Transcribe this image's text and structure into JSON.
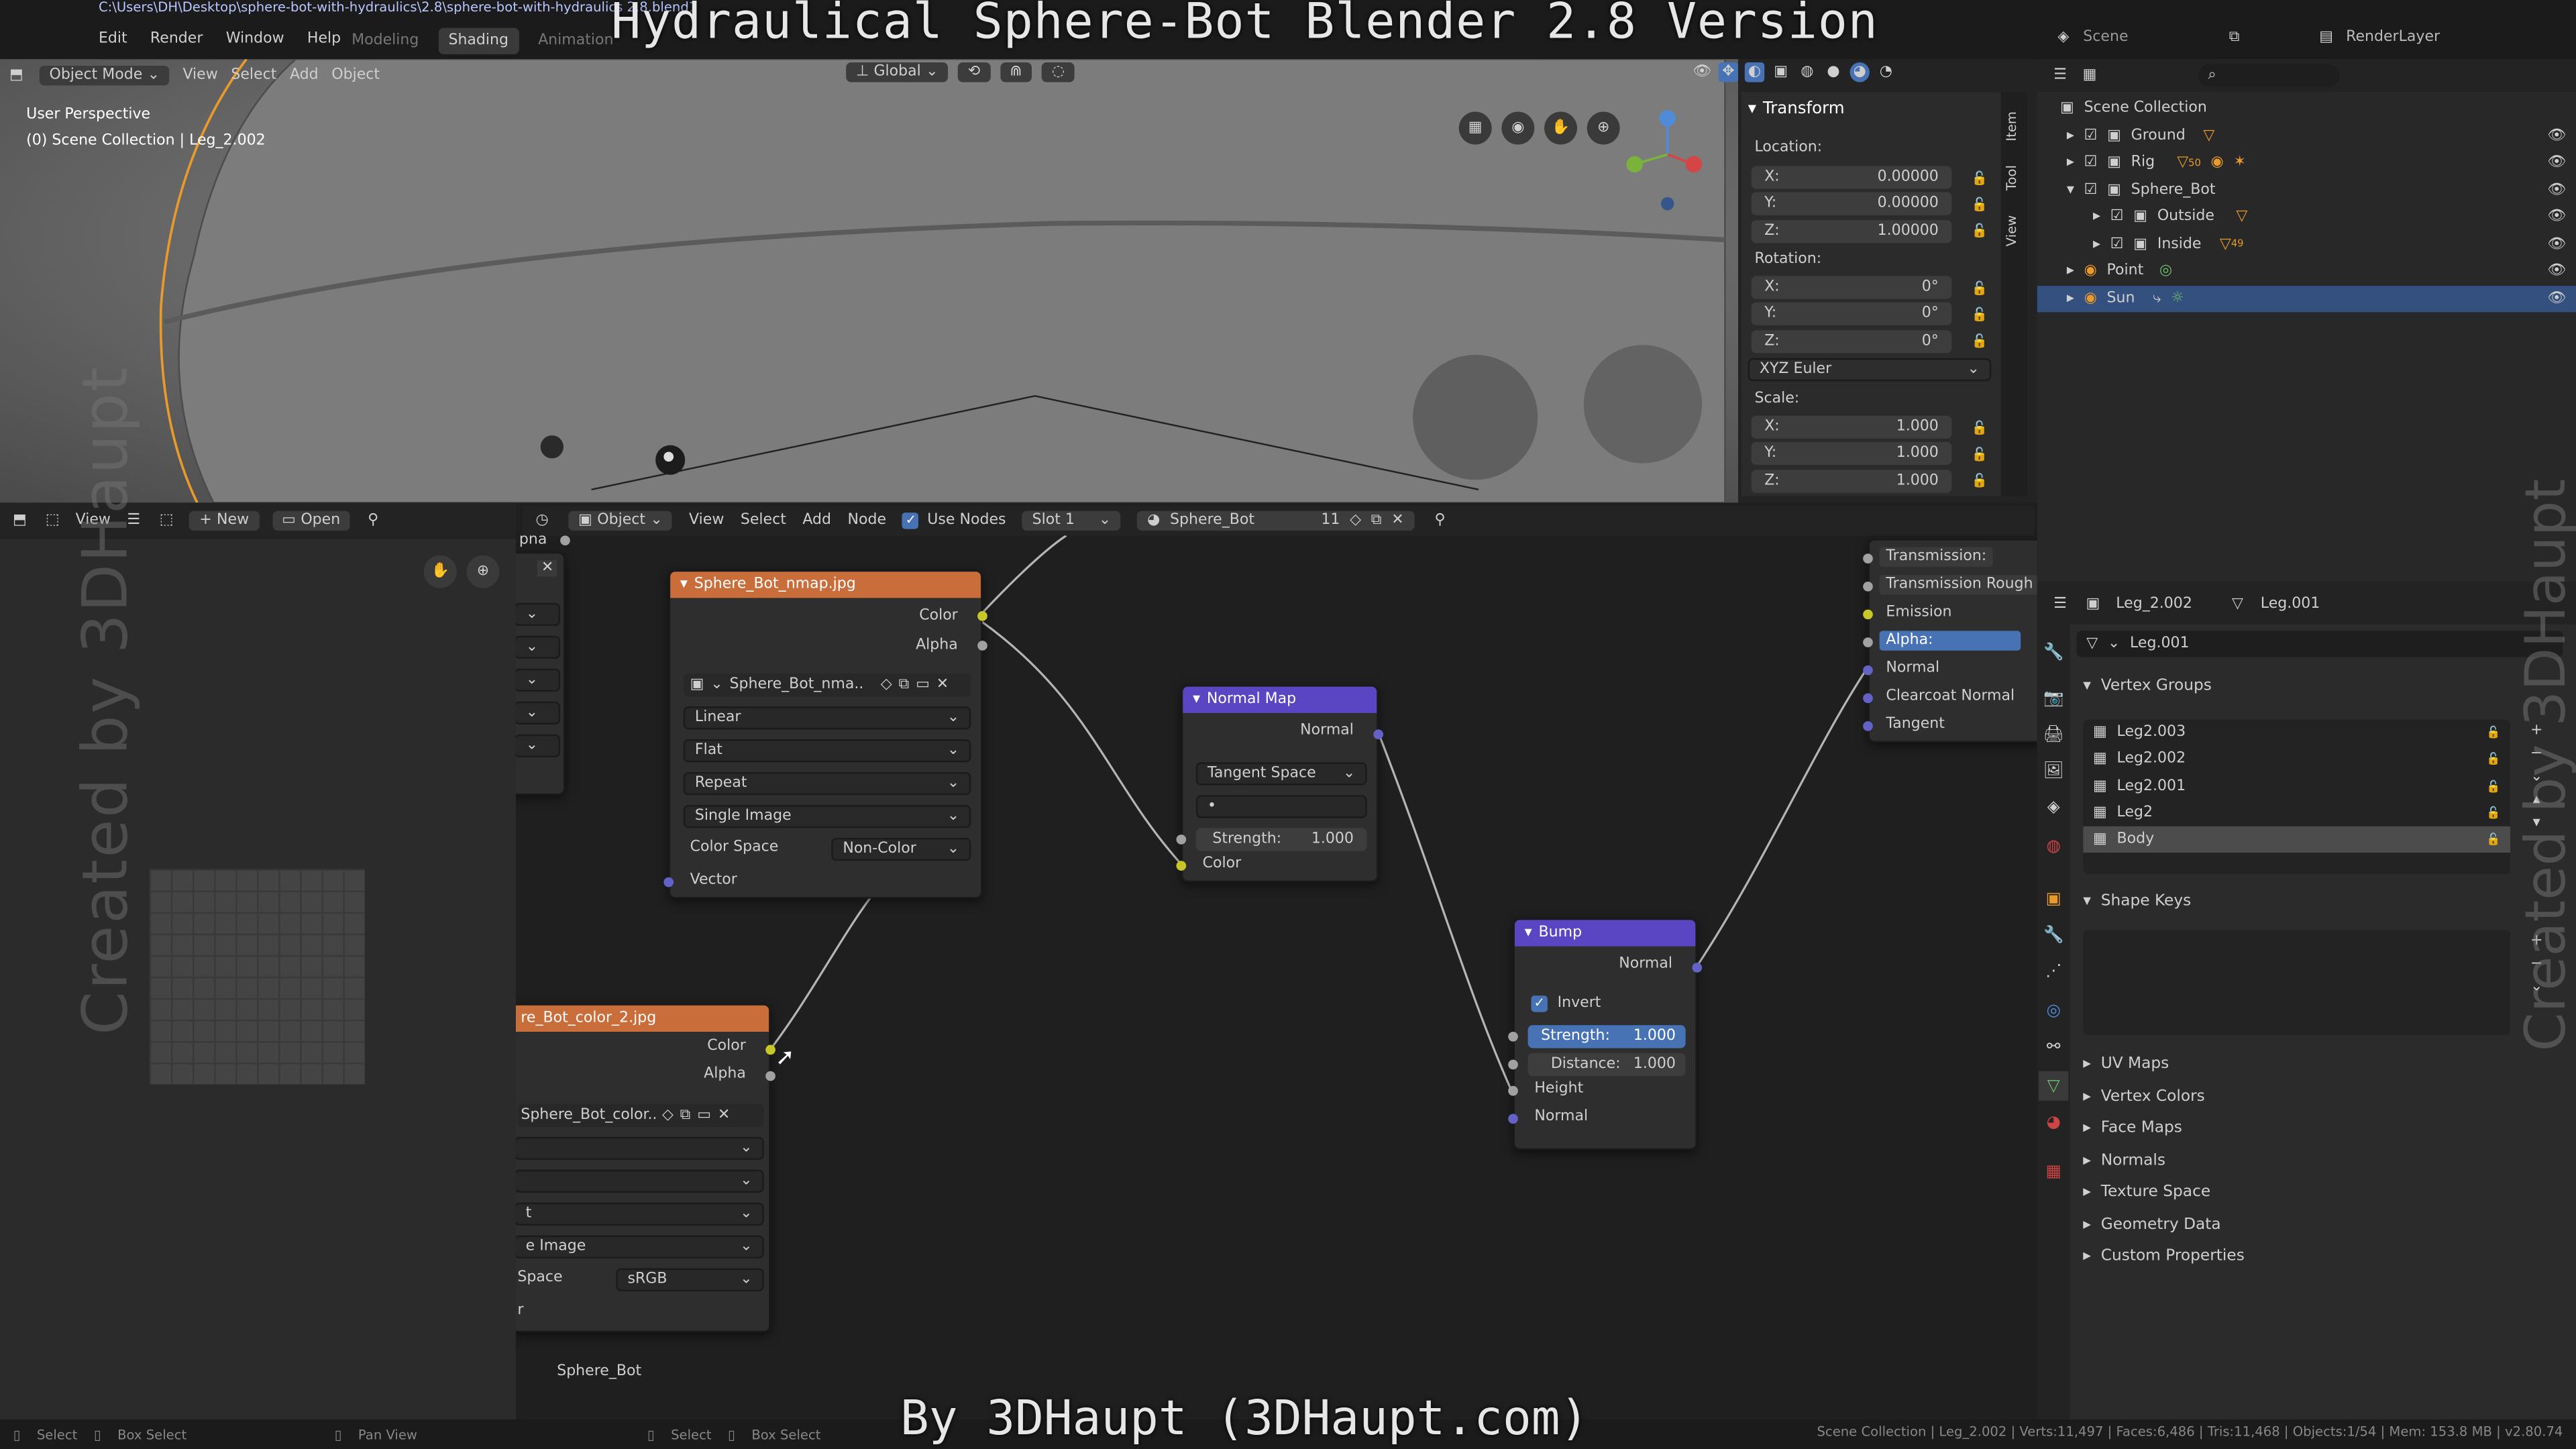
{
  "overlay": {
    "title": "Hydraulical Sphere-Bot Blender 2.8 Version",
    "credit": "By 3DHaupt (3DHaupt.com)",
    "watermark": "Created by 3DHaupt"
  },
  "titlebar": {
    "path": "C:\\Users\\DH\\Desktop\\sphere-bot-with-hydraulics\\2.8\\sphere-bot-with-hydraulics 2.8.blend1"
  },
  "topbar": {
    "menus": [
      "Edit",
      "Render",
      "Window",
      "Help"
    ],
    "workspaces": [
      "Modeling",
      "Shading",
      "Animation"
    ],
    "scene": "Scene",
    "render_layer": "RenderLayer"
  },
  "viewport": {
    "mode": "Object Mode",
    "menus": [
      "View",
      "Select",
      "Add",
      "Object"
    ],
    "transform_orientation": "Global",
    "perspective_label": "User Perspective",
    "collection_label": "(0) Scene Collection | Leg_2.002",
    "side_tabs": [
      "Item",
      "Tool",
      "View"
    ]
  },
  "transform": {
    "title": "Transform",
    "location_label": "Location:",
    "location": [
      {
        "axis": "X:",
        "value": "0.00000"
      },
      {
        "axis": "Y:",
        "value": "0.00000"
      },
      {
        "axis": "Z:",
        "value": "1.00000"
      }
    ],
    "rotation_label": "Rotation:",
    "rotation": [
      {
        "axis": "X:",
        "value": "0°"
      },
      {
        "axis": "Y:",
        "value": "0°"
      },
      {
        "axis": "Z:",
        "value": "0°"
      }
    ],
    "rotation_mode": "XYZ Euler",
    "scale_label": "Scale:",
    "scale": [
      {
        "axis": "X:",
        "value": "1.000"
      },
      {
        "axis": "Y:",
        "value": "1.000"
      },
      {
        "axis": "Z:",
        "value": "1.000"
      }
    ]
  },
  "outliner": {
    "root": "Scene Collection",
    "items": [
      "Ground",
      "Rig",
      "Sphere_Bot",
      "Outside",
      "Inside",
      "Point",
      "Sun"
    ],
    "count_a": "50",
    "count_b": "49"
  },
  "image_editor": {
    "view": "View",
    "new": "New",
    "open": "Open"
  },
  "node_editor": {
    "object": "Object",
    "menus": [
      "View",
      "Select",
      "Add",
      "Node"
    ],
    "use_nodes": "Use Nodes",
    "slot": "Slot 1",
    "material": "Sphere_Bot",
    "users": "11",
    "footer_material": "Sphere_Bot",
    "partial_label": "pha"
  },
  "node_nmap": {
    "title": "Sphere_Bot_nmap.jpg",
    "outputs": [
      "Color",
      "Alpha"
    ],
    "image": "Sphere_Bot_nma..",
    "interpolation": "Linear",
    "projection": "Flat",
    "extension": "Repeat",
    "source": "Single Image",
    "color_space_label": "Color Space",
    "color_space": "Non-Color",
    "input": "Vector"
  },
  "node_color": {
    "title": "re_Bot_color_2.jpg",
    "outputs": [
      "Color",
      "Alpha"
    ],
    "image": "Sphere_Bot_color..",
    "row_t": "t",
    "source": "e Image",
    "color_space_label": "Space",
    "color_space": "sRGB",
    "row_r": "r"
  },
  "node_normal": {
    "title": "Normal Map",
    "output": "Normal",
    "space": "Tangent Space",
    "uv": "•",
    "strength_label": "Strength:",
    "strength": "1.000",
    "input": "Color"
  },
  "node_bump": {
    "title": "Bump",
    "output": "Normal",
    "invert": "Invert",
    "strength_label": "Strength:",
    "strength": "1.000",
    "distance_label": "Distance:",
    "distance": "1.000",
    "inputs": [
      "Height",
      "Normal"
    ]
  },
  "node_bsdf": {
    "inputs": [
      "Transmission:",
      "Transmission Rough",
      "Emission",
      "Alpha:",
      "Normal",
      "Clearcoat Normal",
      "Tangent"
    ]
  },
  "properties": {
    "object": "Leg_2.002",
    "mesh": "Leg.001",
    "mesh_field": "Leg.001",
    "vertex_groups_title": "Vertex Groups",
    "vertex_groups": [
      "Leg2.003",
      "Leg2.002",
      "Leg2.001",
      "Leg2",
      "Body"
    ],
    "shape_keys_title": "Shape Keys",
    "sections": [
      "UV Maps",
      "Vertex Colors",
      "Face Maps",
      "Normals",
      "Texture Space",
      "Geometry Data",
      "Custom Properties"
    ]
  },
  "statusbar": {
    "left": [
      "Select",
      "Box Select",
      "Pan View",
      "Select",
      "Box Select"
    ],
    "right": "Scene Collection | Leg_2.002 | Verts:11,497 | Faces:6,486 | Tris:11,468 | Objects:1/54 | Mem: 153.8 MB | v2.80.74"
  },
  "colors": {
    "accent": "#4772b3",
    "texture_node": "#d9743f",
    "vector_node": "#6a4fcf",
    "socket_color": "#c7c729",
    "socket_vector": "#6363c7",
    "socket_float": "#a1a1a1"
  }
}
